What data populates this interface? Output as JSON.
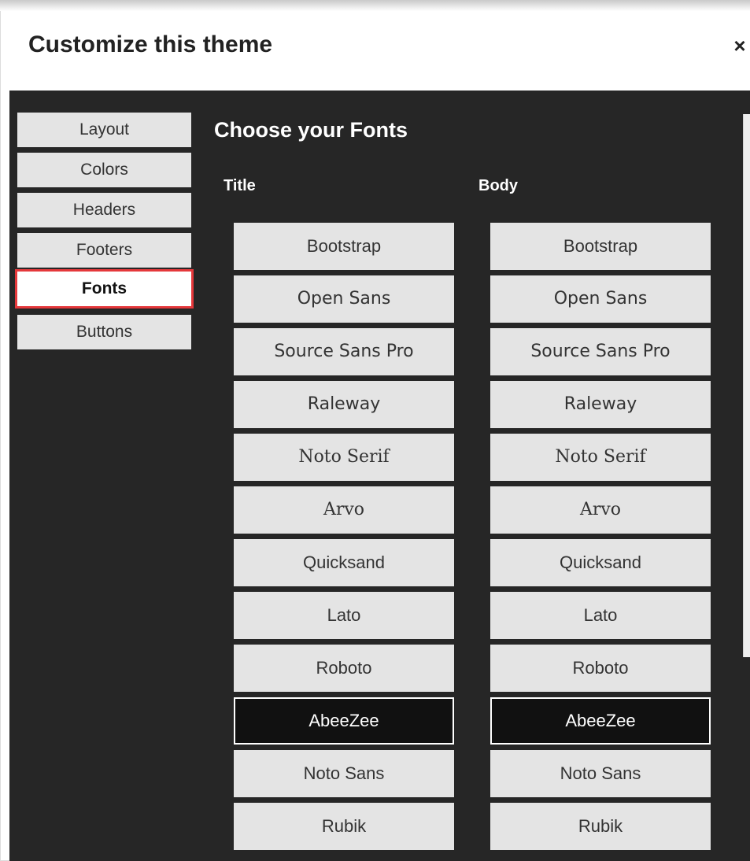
{
  "dialog": {
    "title": "Customize this theme",
    "close_icon": "close-icon",
    "close_glyph": "×"
  },
  "sidebar": {
    "items": [
      {
        "label": "Layout",
        "active": false
      },
      {
        "label": "Colors",
        "active": false
      },
      {
        "label": "Headers",
        "active": false
      },
      {
        "label": "Footers",
        "active": false
      },
      {
        "label": "Fonts",
        "active": true
      },
      {
        "label": "Buttons",
        "active": false
      }
    ],
    "highlight_color": "#e5383b"
  },
  "main": {
    "heading": "Choose your Fonts",
    "title_column_label": "Title",
    "body_column_label": "Body",
    "fonts": [
      "Bootstrap",
      "Open Sans",
      "Source Sans Pro",
      "Raleway",
      "Noto Serif",
      "Arvo",
      "Quicksand",
      "Lato",
      "Roboto",
      "AbeeZee",
      "Noto Sans",
      "Rubik"
    ],
    "title_selected": "AbeeZee",
    "body_selected": "AbeeZee"
  },
  "colors": {
    "panel_background": "#262626",
    "button_background": "#e4e4e4",
    "selected_background": "#111111"
  }
}
